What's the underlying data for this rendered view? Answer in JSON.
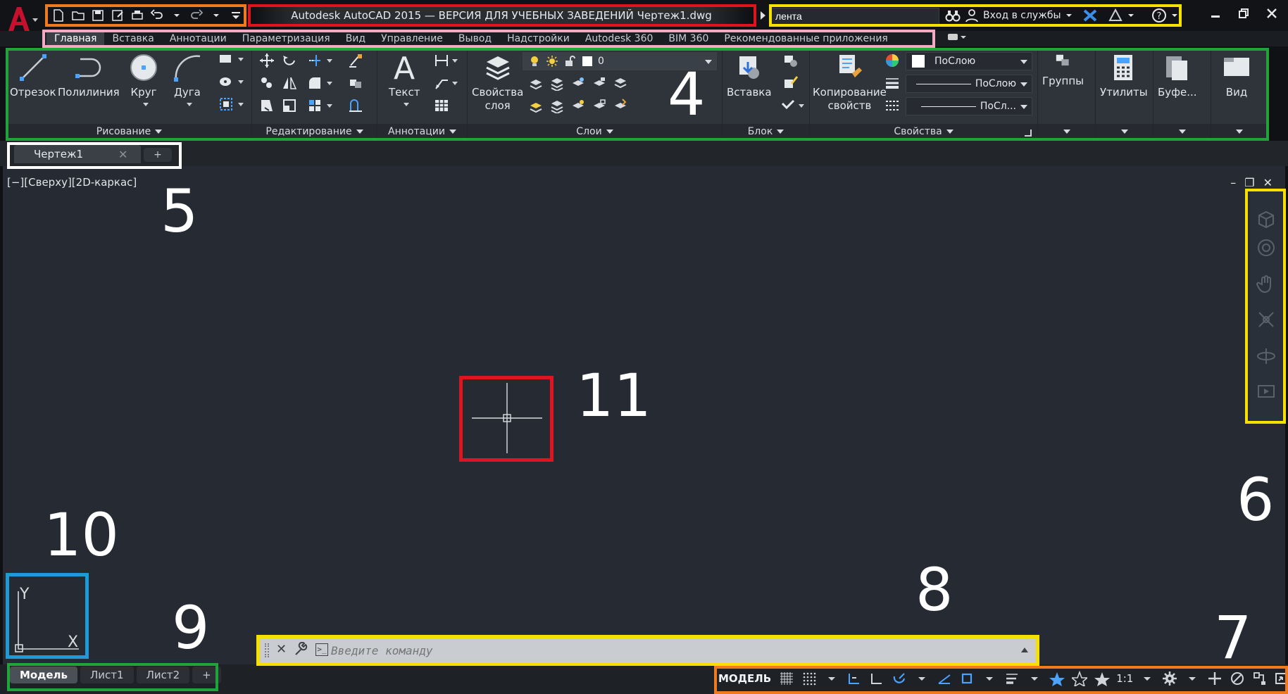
{
  "titlebar": {
    "title": "Autodesk AutoCAD 2015 — ВЕРСИЯ ДЛЯ УЧЕБНЫХ ЗАВЕДЕНИЙ    Чертеж1.dwg",
    "search_value": "лента",
    "signin_label": "Вход в службы"
  },
  "ribbon_tabs": [
    "Главная",
    "Вставка",
    "Аннотации",
    "Параметризация",
    "Вид",
    "Управление",
    "Вывод",
    "Надстройки",
    "Autodesk 360",
    "BIM 360",
    "Рекомендованные приложения"
  ],
  "panels": {
    "draw": {
      "title": "Рисование",
      "tools": [
        "Отрезок",
        "Полилиния",
        "Круг",
        "Дуга"
      ]
    },
    "modify": {
      "title": "Редактирование"
    },
    "annotation": {
      "title": "Аннотации",
      "text_tool": "Текст"
    },
    "layers": {
      "title": "Слои",
      "props_tool_l1": "Свойства",
      "props_tool_l2": "слоя",
      "current_layer": "0"
    },
    "block": {
      "title": "Блок",
      "insert_tool": "Вставка"
    },
    "properties": {
      "title": "Свойства",
      "match_l1": "Копирование",
      "match_l2": "свойств",
      "color": "ПоСлою",
      "linetype": "ПоСлою",
      "lineweight": "ПоСл..."
    },
    "groups": {
      "title": "Группы"
    },
    "utilities": {
      "title": "Утилиты"
    },
    "clipboard": {
      "title": "Буфе..."
    },
    "view": {
      "title": "Вид"
    }
  },
  "doc_tab": {
    "name": "Чертеж1"
  },
  "viewport": {
    "label": "[−][Сверху][2D-каркас]"
  },
  "ucs": {
    "y": "Y",
    "x": "X"
  },
  "command_line": {
    "placeholder": "Введите команду"
  },
  "layout_tabs": [
    "Модель",
    "Лист1",
    "Лист2"
  ],
  "status": {
    "model": "МОДЕЛЬ",
    "scale": "1:1"
  },
  "annotations": {
    "n4": "4",
    "n5": "5",
    "n6": "6",
    "n7": "7",
    "n8": "8",
    "n9": "9",
    "n10": "10",
    "n11": "11"
  },
  "colors": {
    "red": "#e0141e",
    "orange": "#f07b1f",
    "yellow": "#f5e000",
    "green": "#1fa33a",
    "pink": "#f3a9c2",
    "white": "#ffffff",
    "blue": "#1e9ad6",
    "acad_red": "#c8102e"
  }
}
